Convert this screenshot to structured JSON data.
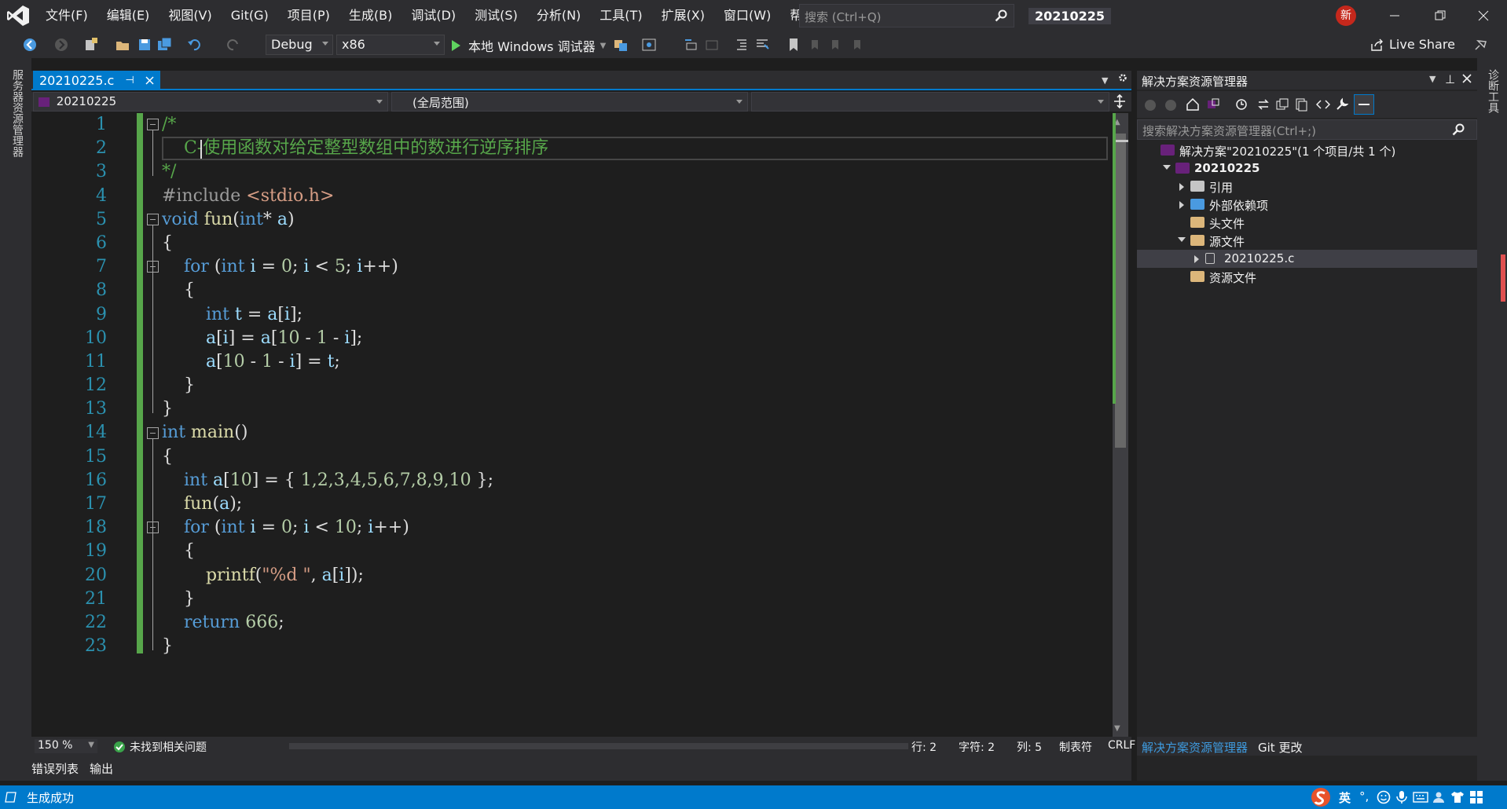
{
  "titlebar": {
    "menu": [
      "文件(F)",
      "编辑(E)",
      "视图(V)",
      "Git(G)",
      "项目(P)",
      "生成(B)",
      "调试(D)",
      "测试(S)",
      "分析(N)",
      "工具(T)",
      "扩展(X)",
      "窗口(W)",
      "帮助(H)"
    ],
    "search_placeholder": "搜索 (Ctrl+Q)",
    "project_name": "20210225",
    "badge": "新"
  },
  "toolbar": {
    "config": "Debug",
    "platform": "x86",
    "run_label": "本地 Windows 调试器",
    "live_share": "Live Share"
  },
  "left_strip": {
    "label": "服务器资源管理器"
  },
  "right_strip": {
    "label": "诊断工具"
  },
  "editor": {
    "tab_label": "20210225.c",
    "nav_project": "20210225",
    "nav_scope": "(全局范围)",
    "line_numbers": [
      "1",
      "2",
      "3",
      "4",
      "5",
      "6",
      "7",
      "8",
      "9",
      "10",
      "11",
      "12",
      "13",
      "14",
      "15",
      "16",
      "17",
      "18",
      "19",
      "20",
      "21",
      "22",
      "23"
    ],
    "code_lines": [
      [
        [
          "cm",
          "/*"
        ]
      ],
      [
        [
          "cm",
          "    C-使用函数对给定整型数组中的数进行逆序排序"
        ]
      ],
      [
        [
          "cm",
          "*/"
        ]
      ],
      [
        [
          "pp",
          "#include "
        ],
        [
          "str",
          "<stdio.h>"
        ]
      ],
      [
        [
          "kw",
          "void "
        ],
        [
          "fn",
          "fun"
        ],
        [
          "pl",
          "("
        ],
        [
          "kw",
          "int"
        ],
        [
          "pl",
          "* "
        ],
        [
          "var",
          "a"
        ],
        [
          "pl",
          ")"
        ]
      ],
      [
        [
          "pl",
          "{"
        ]
      ],
      [
        [
          "pl",
          "    "
        ],
        [
          "kw",
          "for "
        ],
        [
          "pl",
          "("
        ],
        [
          "kw",
          "int "
        ],
        [
          "var",
          "i"
        ],
        [
          "pl",
          " = "
        ],
        [
          "num",
          "0"
        ],
        [
          "pl",
          "; "
        ],
        [
          "var",
          "i"
        ],
        [
          "pl",
          " < "
        ],
        [
          "num",
          "5"
        ],
        [
          "pl",
          "; "
        ],
        [
          "var",
          "i"
        ],
        [
          "pl",
          "++)"
        ]
      ],
      [
        [
          "pl",
          "    {"
        ]
      ],
      [
        [
          "pl",
          "        "
        ],
        [
          "kw",
          "int "
        ],
        [
          "var",
          "t"
        ],
        [
          "pl",
          " = "
        ],
        [
          "var",
          "a"
        ],
        [
          "pl",
          "["
        ],
        [
          "var",
          "i"
        ],
        [
          "pl",
          "];"
        ]
      ],
      [
        [
          "pl",
          "        "
        ],
        [
          "var",
          "a"
        ],
        [
          "pl",
          "["
        ],
        [
          "var",
          "i"
        ],
        [
          "pl",
          "] = "
        ],
        [
          "var",
          "a"
        ],
        [
          "pl",
          "["
        ],
        [
          "num",
          "10"
        ],
        [
          "pl",
          " - "
        ],
        [
          "num",
          "1"
        ],
        [
          "pl",
          " - "
        ],
        [
          "var",
          "i"
        ],
        [
          "pl",
          "];"
        ]
      ],
      [
        [
          "pl",
          "        "
        ],
        [
          "var",
          "a"
        ],
        [
          "pl",
          "["
        ],
        [
          "num",
          "10"
        ],
        [
          "pl",
          " - "
        ],
        [
          "num",
          "1"
        ],
        [
          "pl",
          " - "
        ],
        [
          "var",
          "i"
        ],
        [
          "pl",
          "] = "
        ],
        [
          "var",
          "t"
        ],
        [
          "pl",
          ";"
        ]
      ],
      [
        [
          "pl",
          "    }"
        ]
      ],
      [
        [
          "pl",
          "}"
        ]
      ],
      [
        [
          "kw",
          "int "
        ],
        [
          "fn",
          "main"
        ],
        [
          "pl",
          "()"
        ]
      ],
      [
        [
          "pl",
          "{"
        ]
      ],
      [
        [
          "pl",
          "    "
        ],
        [
          "kw",
          "int "
        ],
        [
          "var",
          "a"
        ],
        [
          "pl",
          "["
        ],
        [
          "num",
          "10"
        ],
        [
          "pl",
          "] = { "
        ],
        [
          "num",
          "1,2,3,4,5,6,7,8,9,10"
        ],
        [
          "pl",
          " };"
        ]
      ],
      [
        [
          "pl",
          "    "
        ],
        [
          "fn",
          "fun"
        ],
        [
          "pl",
          "("
        ],
        [
          "var",
          "a"
        ],
        [
          "pl",
          ");"
        ]
      ],
      [
        [
          "pl",
          "    "
        ],
        [
          "kw",
          "for "
        ],
        [
          "pl",
          "("
        ],
        [
          "kw",
          "int "
        ],
        [
          "var",
          "i"
        ],
        [
          "pl",
          " = "
        ],
        [
          "num",
          "0"
        ],
        [
          "pl",
          "; "
        ],
        [
          "var",
          "i"
        ],
        [
          "pl",
          " < "
        ],
        [
          "num",
          "10"
        ],
        [
          "pl",
          "; "
        ],
        [
          "var",
          "i"
        ],
        [
          "pl",
          "++)"
        ]
      ],
      [
        [
          "pl",
          "    {"
        ]
      ],
      [
        [
          "pl",
          "        "
        ],
        [
          "fn",
          "printf"
        ],
        [
          "pl",
          "("
        ],
        [
          "str",
          "\"%d \""
        ],
        [
          "pl",
          ", "
        ],
        [
          "var",
          "a"
        ],
        [
          "pl",
          "["
        ],
        [
          "var",
          "i"
        ],
        [
          "pl",
          "]);"
        ]
      ],
      [
        [
          "pl",
          "    }"
        ]
      ],
      [
        [
          "pl",
          "    "
        ],
        [
          "kw",
          "return "
        ],
        [
          "num",
          "666"
        ],
        [
          "pl",
          ";"
        ]
      ],
      [
        [
          "pl",
          "}"
        ]
      ]
    ],
    "zoom": "150 %",
    "issues": "未找到相关问题",
    "row": "行: 2",
    "char": "字符: 2",
    "col": "列: 5",
    "tab_mode": "制表符",
    "eol": "CRLF"
  },
  "bottom_tabs": [
    "错误列表",
    "输出"
  ],
  "solution_explorer": {
    "title": "解决方案资源管理器",
    "search_placeholder": "搜索解决方案资源管理器(Ctrl+;)",
    "tree": [
      {
        "label": "解决方案\"20210225\"(1 个项目/共 1 个)",
        "indent": 0,
        "arrow": "none",
        "icon": "solution"
      },
      {
        "label": "20210225",
        "indent": 1,
        "arrow": "down",
        "icon": "project",
        "bold": true
      },
      {
        "label": "引用",
        "indent": 2,
        "arrow": "right",
        "icon": "ref"
      },
      {
        "label": "外部依赖项",
        "indent": 2,
        "arrow": "right",
        "icon": "ext"
      },
      {
        "label": "头文件",
        "indent": 2,
        "arrow": "none",
        "icon": "folder"
      },
      {
        "label": "源文件",
        "indent": 2,
        "arrow": "down",
        "icon": "folder"
      },
      {
        "label": "20210225.c",
        "indent": 3,
        "arrow": "right",
        "icon": "file",
        "selected": true
      },
      {
        "label": "资源文件",
        "indent": 2,
        "arrow": "none",
        "icon": "folder"
      }
    ],
    "bottom_tabs": [
      "解决方案资源管理器",
      "Git 更改"
    ]
  },
  "statusbar": {
    "text": "生成成功",
    "ime": [
      "英"
    ]
  },
  "colors": {
    "accent": "#007acc",
    "comment": "#57a64a",
    "keyword": "#569cd6"
  }
}
